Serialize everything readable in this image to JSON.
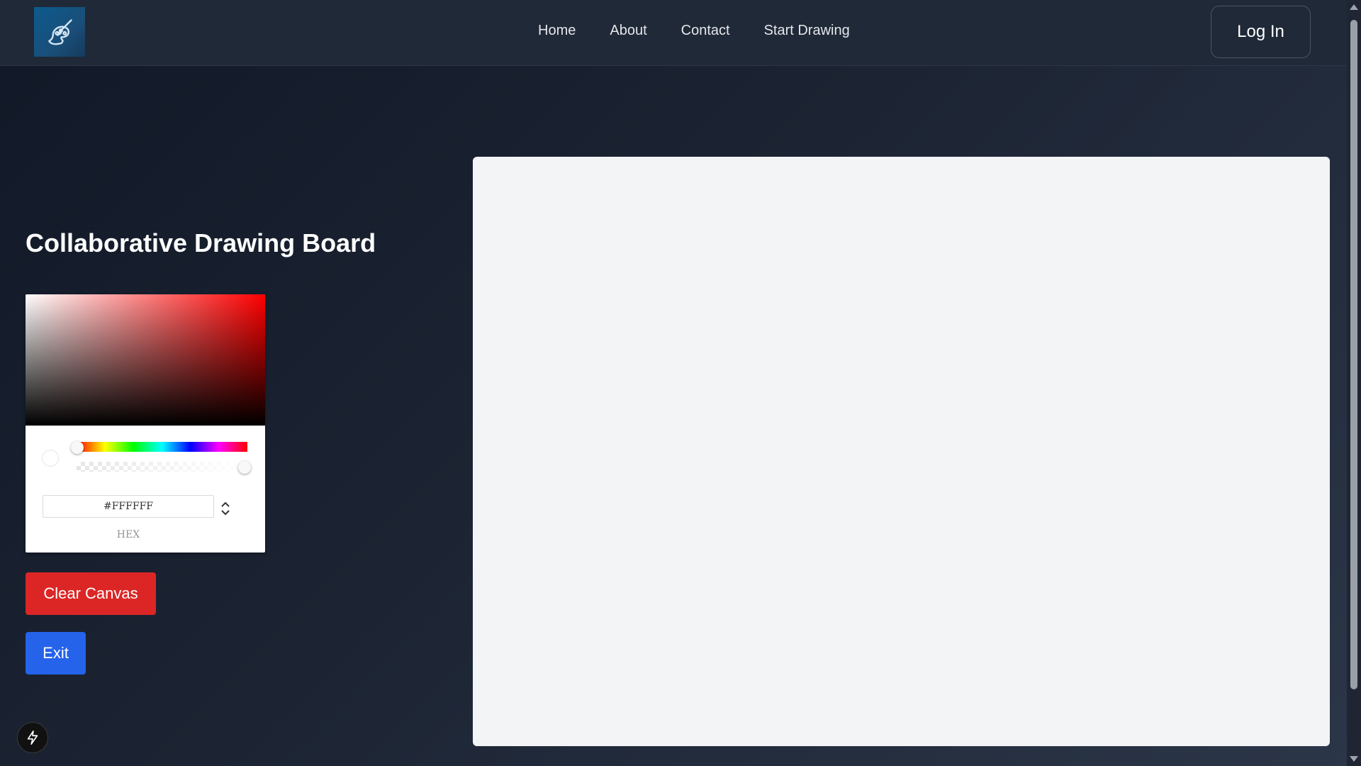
{
  "header": {
    "logo_icon": "palette-brush-icon",
    "nav": [
      {
        "label": "Home"
      },
      {
        "label": "About"
      },
      {
        "label": "Contact"
      },
      {
        "label": "Start Drawing"
      }
    ],
    "login_label": "Log In"
  },
  "main": {
    "title": "Collaborative Drawing Board",
    "color_picker": {
      "hex_value": "#FFFFFF",
      "hex_label": "HEX",
      "selected_color": "#FFFFFF",
      "hue_color": "#FF0000",
      "alpha": 1
    },
    "clear_label": "Clear Canvas",
    "exit_label": "Exit"
  },
  "colors": {
    "header_bg": "#1f2937",
    "clear_button": "#dc2626",
    "exit_button": "#2563eb",
    "canvas_bg": "#f3f4f6"
  },
  "widgets": {
    "flash_icon": "lightning-bolt-icon"
  }
}
